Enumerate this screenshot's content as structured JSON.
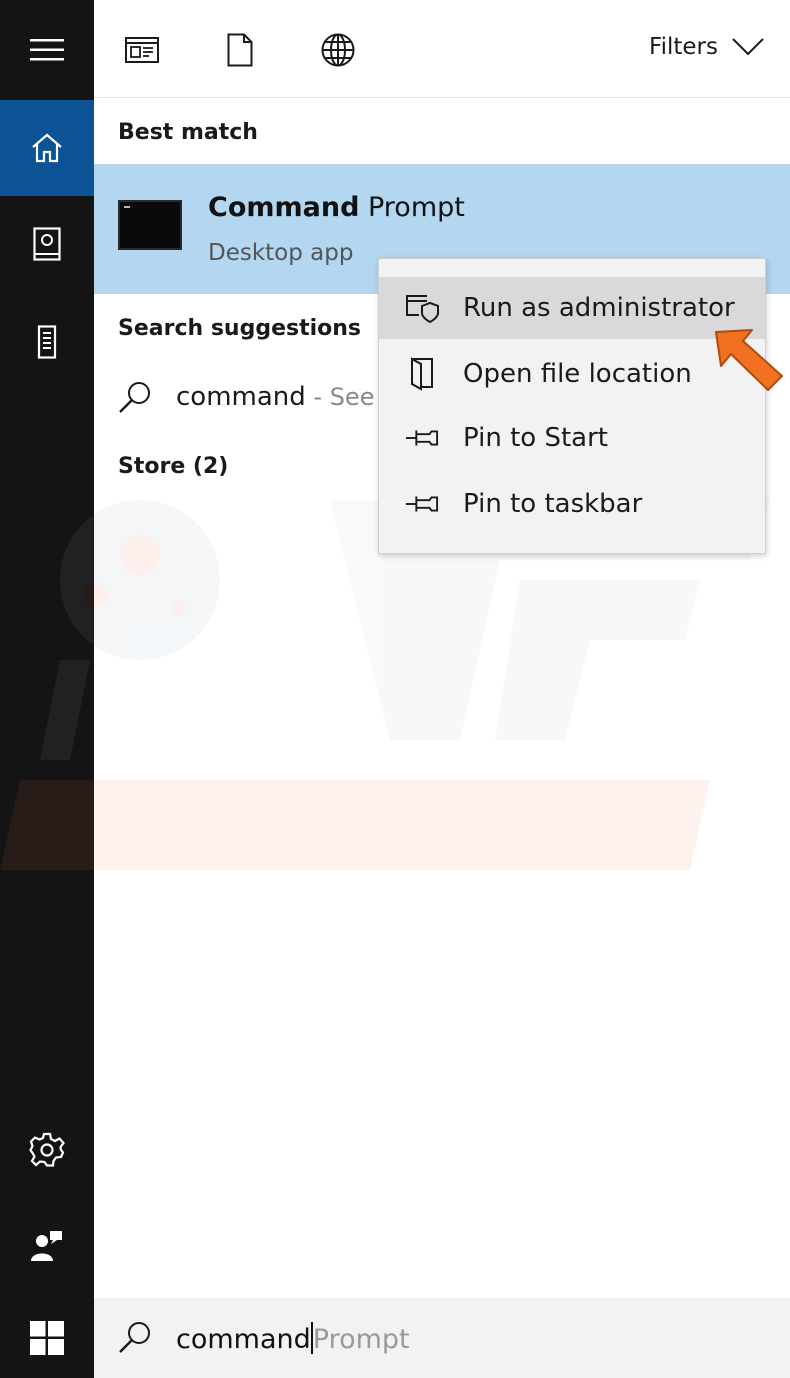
{
  "top_bar": {
    "filters_label": "Filters"
  },
  "best_match": {
    "header": "Best match",
    "title_bold": "Command",
    "title_rest": " Prompt",
    "subtitle": "Desktop app"
  },
  "search_suggestions": {
    "header": "Search suggestions",
    "item_text": "command",
    "item_hint": " - See"
  },
  "store": {
    "header": "Store (2)"
  },
  "context_menu": {
    "items": [
      {
        "label": "Run as administrator",
        "icon": "shield-window-icon"
      },
      {
        "label": "Open file location",
        "icon": "folder-open-icon"
      },
      {
        "label": "Pin to Start",
        "icon": "pin-icon"
      },
      {
        "label": "Pin to taskbar",
        "icon": "pin-icon"
      }
    ]
  },
  "search_box": {
    "typed": "command",
    "autocomplete": "Prompt"
  },
  "colors": {
    "rail_bg": "#141414",
    "rail_active": "#0b5394",
    "highlight": "#b3d6f1",
    "arrow": "#f37021"
  },
  "watermark_text": "PC risk.com"
}
